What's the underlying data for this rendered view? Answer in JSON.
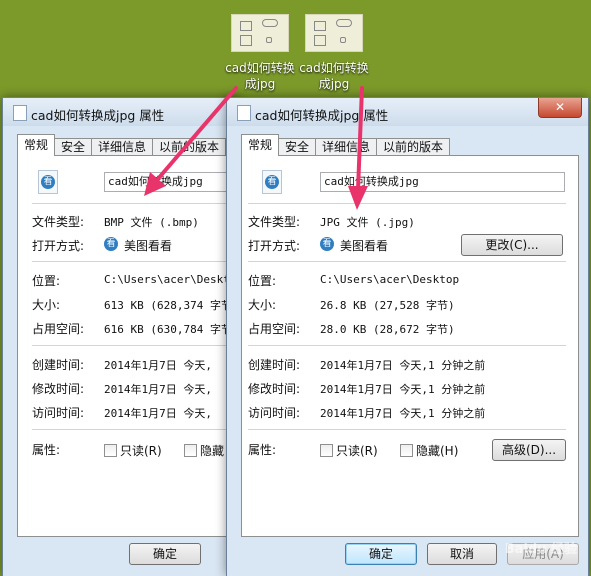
{
  "desktop": {
    "icons": [
      {
        "label_line1": "cad如何转换",
        "label_line2": "成jpg"
      },
      {
        "label_line1": "cad如何转换",
        "label_line2": "成jpg"
      }
    ]
  },
  "windows": [
    {
      "title": "cad如何转换成jpg 属性",
      "close": "✕",
      "tabs": [
        "常规",
        "安全",
        "详细信息",
        "以前的版本"
      ],
      "filename": "cad如何转换成jpg",
      "rows": {
        "type_label": "文件类型:",
        "type_value": "BMP 文件 (.bmp)",
        "open_label": "打开方式:",
        "open_value": "美图看看",
        "location_label": "位置:",
        "location_value": "C:\\Users\\acer\\Deskt",
        "size_label": "大小:",
        "size_value": "613 KB (628,374 字节",
        "disk_label": "占用空间:",
        "disk_value": "616 KB (630,784 字节",
        "created_label": "创建时间:",
        "created_value": "2014年1月7日 今天,",
        "modified_label": "修改时间:",
        "modified_value": "2014年1月7日 今天,",
        "accessed_label": "访问时间:",
        "accessed_value": "2014年1月7日 今天,",
        "attr_label": "属性:",
        "readonly": "只读(R)",
        "hidden": "隐藏"
      },
      "ok": "确定"
    },
    {
      "title": "cad如何转换成jpg 属性",
      "tabs": [
        "常规",
        "安全",
        "详细信息",
        "以前的版本"
      ],
      "filename": "cad如何转换成jpg",
      "rows": {
        "type_label": "文件类型:",
        "type_value": "JPG 文件 (.jpg)",
        "open_label": "打开方式:",
        "open_value": "美图看看",
        "change": "更改(C)...",
        "location_label": "位置:",
        "location_value": "C:\\Users\\acer\\Desktop",
        "size_label": "大小:",
        "size_value": "26.8 KB (27,528 字节)",
        "disk_label": "占用空间:",
        "disk_value": "28.0 KB (28,672 字节)",
        "created_label": "创建时间:",
        "created_value": "2014年1月7日 今天,1 分钟之前",
        "modified_label": "修改时间:",
        "modified_value": "2014年1月7日 今天,1 分钟之前",
        "accessed_label": "访问时间:",
        "accessed_value": "2014年1月7日 今天,1 分钟之前",
        "attr_label": "属性:",
        "readonly": "只读(R)",
        "hidden": "隐藏(H)",
        "advanced": "高级(D)..."
      },
      "ok": "确定",
      "cancel": "取消",
      "apply": "应用(A)"
    }
  ],
  "watermark": "Baidu 经验",
  "colors": {
    "desktop": "#7c9a2a",
    "arrow": "#e8336b",
    "window_frame": "#d9e6f3"
  }
}
